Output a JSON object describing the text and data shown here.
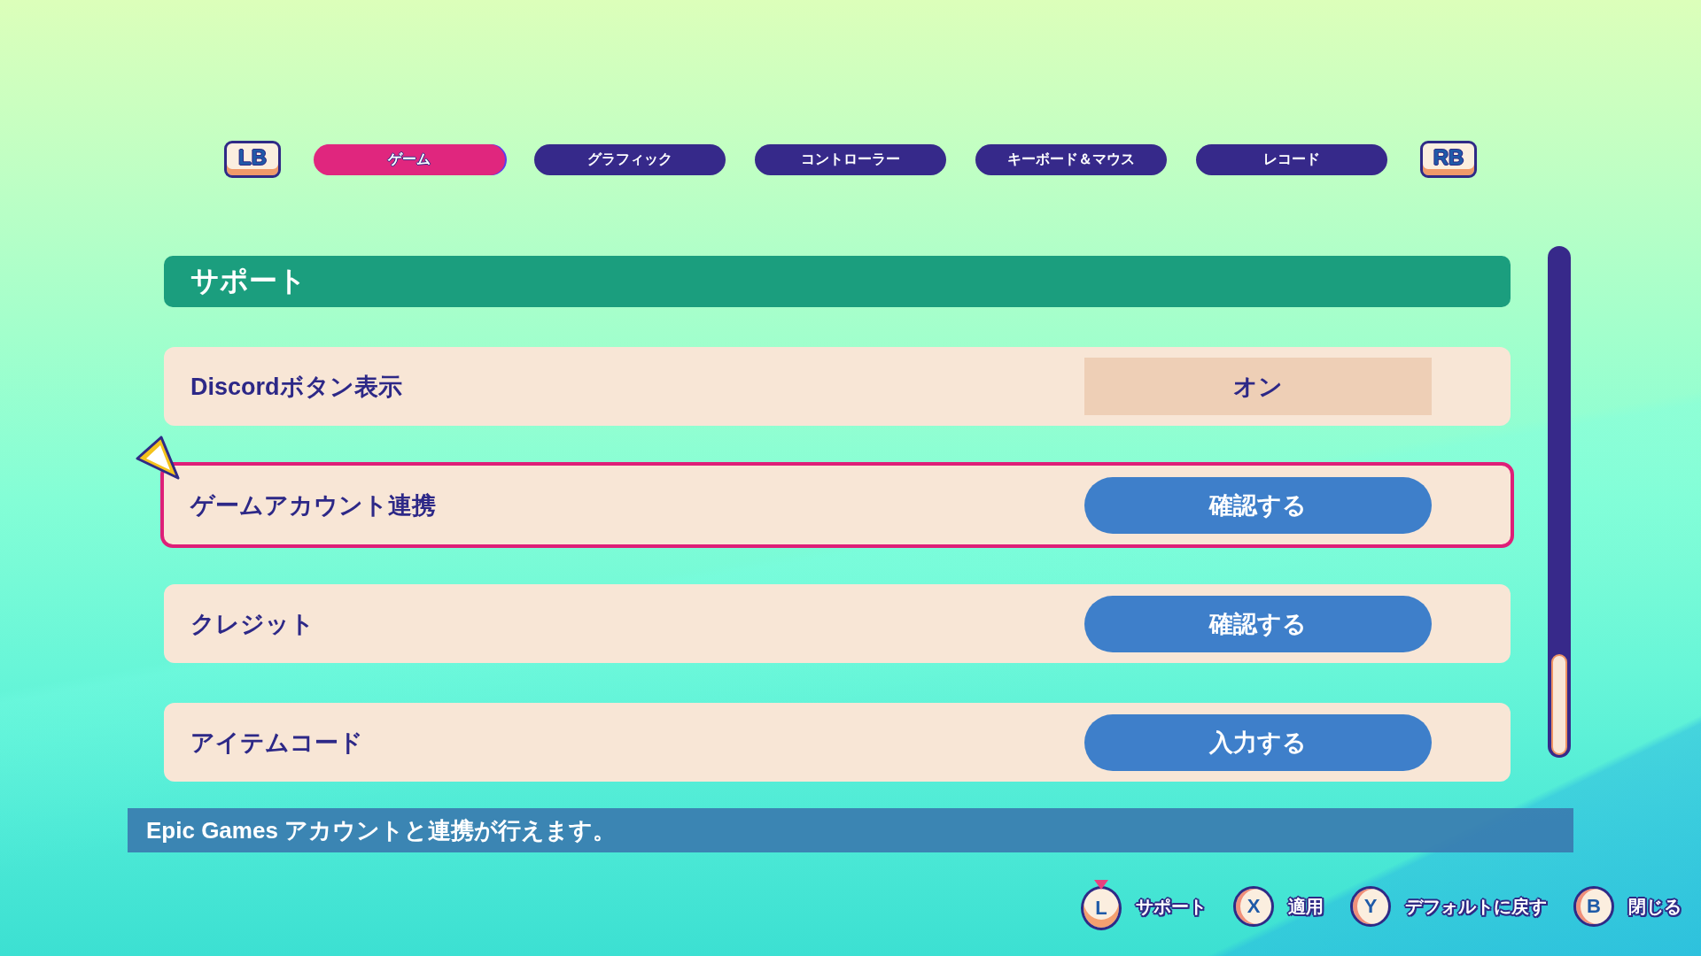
{
  "tab_bar": {
    "left_key": "LB",
    "tabs": [
      {
        "label": "ゲーム",
        "selected": true
      },
      {
        "label": "グラフィック",
        "selected": false
      },
      {
        "label": "コントローラー",
        "selected": false
      },
      {
        "label": "キーボード＆マウス",
        "selected": false
      },
      {
        "label": "レコード",
        "selected": false
      }
    ],
    "right_key": "RB"
  },
  "section": {
    "title": "サポート"
  },
  "settings": [
    {
      "label": "Discordボタン表示",
      "kind": "value",
      "value": "オン",
      "selected": false
    },
    {
      "label": "ゲームアカウント連携",
      "kind": "action",
      "value": "確認する",
      "selected": true
    },
    {
      "label": "クレジット",
      "kind": "action",
      "value": "確認する",
      "selected": false
    },
    {
      "label": "アイテムコード",
      "kind": "action",
      "value": "入力する",
      "selected": false
    }
  ],
  "description": "Epic Games アカウントと連携が行えます。",
  "footer_hints": [
    {
      "key": "L",
      "kind": "stick",
      "label": "サポート"
    },
    {
      "key": "X",
      "kind": "button",
      "label": "適用"
    },
    {
      "key": "Y",
      "kind": "button",
      "label": "デフォルトに戻す"
    },
    {
      "key": "B",
      "kind": "button",
      "label": "閉じる"
    }
  ]
}
